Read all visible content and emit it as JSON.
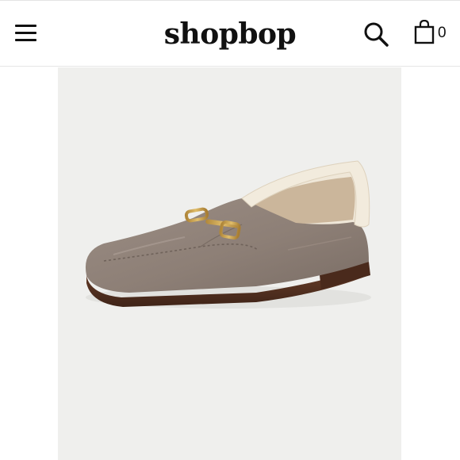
{
  "header": {
    "logo_text": "shopbop",
    "cart_count": "0",
    "icons": {
      "menu": "hamburger-menu-icon",
      "search": "search-icon",
      "bag": "shopping-bag-icon"
    }
  },
  "product": {
    "image": "suede-loafer-with-shearling-lining",
    "colors": {
      "suede": "#8f8178",
      "shearling": "#efe7d8",
      "hardware": "#c9a04a",
      "sole": "#5a3524"
    }
  }
}
